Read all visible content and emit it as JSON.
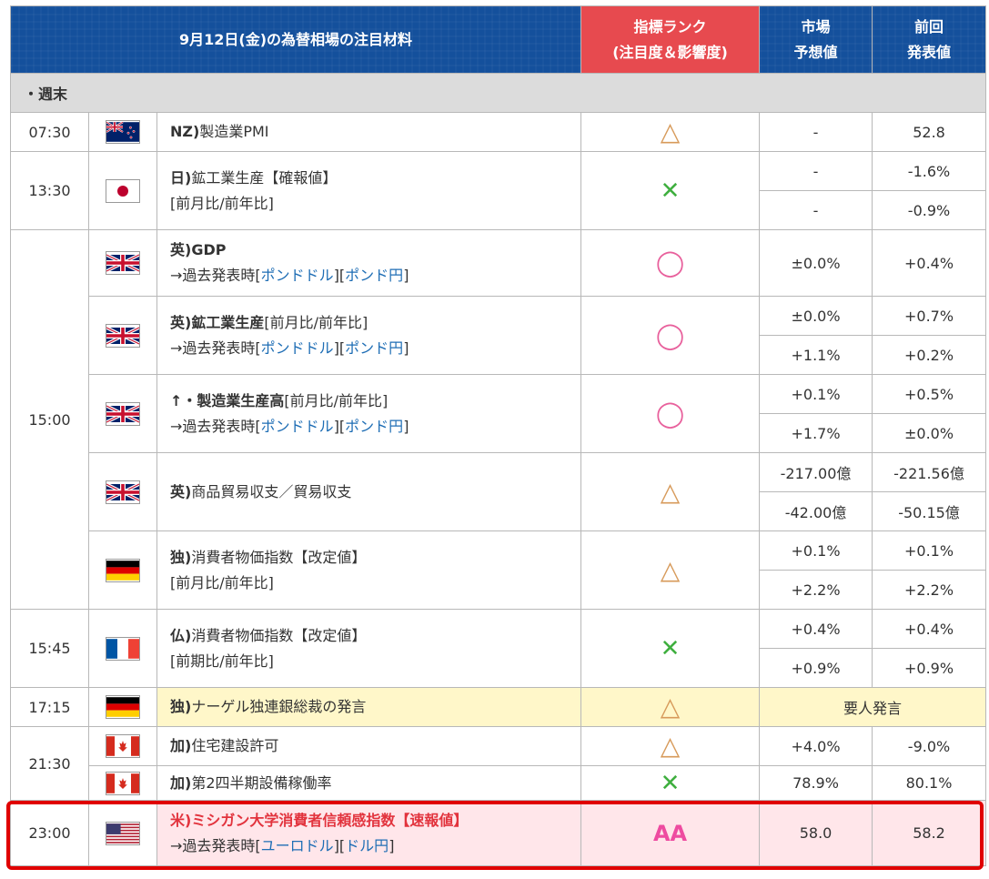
{
  "header": {
    "title": "9月12日(金)の為替相場の注目材料",
    "rank_line1": "指標ランク",
    "rank_line2": "(注目度＆影響度)",
    "forecast_line1": "市場",
    "forecast_line2": "予想値",
    "previous_line1": "前回",
    "previous_line2": "発表値"
  },
  "section": {
    "label": "・週末"
  },
  "symbols": {
    "triangle": "△",
    "circle": "◯",
    "cross": "✕",
    "aa": "AA"
  },
  "link_prefix": "→過去発表時",
  "rows": {
    "r0730": {
      "time": "07:30",
      "country": "NZ)",
      "name": "製造業PMI",
      "f": "-",
      "p": "52.8"
    },
    "r1330": {
      "time": "13:30",
      "country": "日)",
      "name": "鉱工業生産【確報値】",
      "sub": "[前月比/前年比]",
      "f1": "-",
      "p1": "-1.6%",
      "f2": "-",
      "p2": "-0.9%"
    },
    "gdp": {
      "time": "15:00",
      "country": "英)",
      "name_bold": "GDP",
      "link1": "ポンドドル",
      "link2": "ポンド円",
      "f": "±0.0%",
      "p": "+0.4%"
    },
    "ip": {
      "country": "英)",
      "name_bold": "鉱工業生産",
      "name": "[前月比/前年比]",
      "link1": "ポンドドル",
      "link2": "ポンド円",
      "f1": "±0.0%",
      "p1": "+0.7%",
      "f2": "+1.1%",
      "p2": "+0.2%"
    },
    "mfg": {
      "name_bold": "↑・製造業生産高",
      "name": "[前月比/前年比]",
      "link1": "ポンドドル",
      "link2": "ポンド円",
      "f1": "+0.1%",
      "p1": "+0.5%",
      "f2": "+1.7%",
      "p2": "±0.0%"
    },
    "trade": {
      "country": "英)",
      "name": "商品貿易収支／貿易収支",
      "f1": "-217.00億",
      "p1": "-221.56億",
      "f2": "-42.00億",
      "p2": "-50.15億"
    },
    "decpi": {
      "country": "独)",
      "name": "消費者物価指数【改定値】",
      "sub": "[前月比/前年比]",
      "f1": "+0.1%",
      "p1": "+0.1%",
      "f2": "+2.2%",
      "p2": "+2.2%"
    },
    "frcpi": {
      "time": "15:45",
      "country": "仏)",
      "name": "消費者物価指数【改定値】",
      "sub": "[前期比/前年比]",
      "f1": "+0.4%",
      "p1": "+0.4%",
      "f2": "+0.9%",
      "p2": "+0.9%"
    },
    "nagel": {
      "time": "17:15",
      "country": "独)",
      "name": "ナーゲル独連銀総裁の発言",
      "note": "要人発言"
    },
    "permits": {
      "time": "21:30",
      "country": "加)",
      "name": "住宅建設許可",
      "f": "+4.0%",
      "p": "-9.0%"
    },
    "capu": {
      "country": "加)",
      "name": "第2四半期設備稼働率",
      "f": "78.9%",
      "p": "80.1%"
    },
    "mich": {
      "time": "23:00",
      "country": "米)",
      "name": "ミシガン大学消費者信頼感指数【速報値】",
      "link1": "ユーロドル",
      "link2": "ドル円",
      "f": "58.0",
      "p": "58.2"
    }
  },
  "flags": {
    "nz": "nz-flag-icon",
    "jp": "japan-flag-icon",
    "uk": "uk-flag-icon",
    "de": "germany-flag-icon",
    "fr": "france-flag-icon",
    "ca": "canada-flag-icon",
    "us": "us-flag-icon"
  },
  "colors": {
    "header_blue": "#14509c",
    "rank_red": "#e74a4f",
    "highlight_red": "#e00000",
    "link_blue": "#1f6eb5"
  }
}
